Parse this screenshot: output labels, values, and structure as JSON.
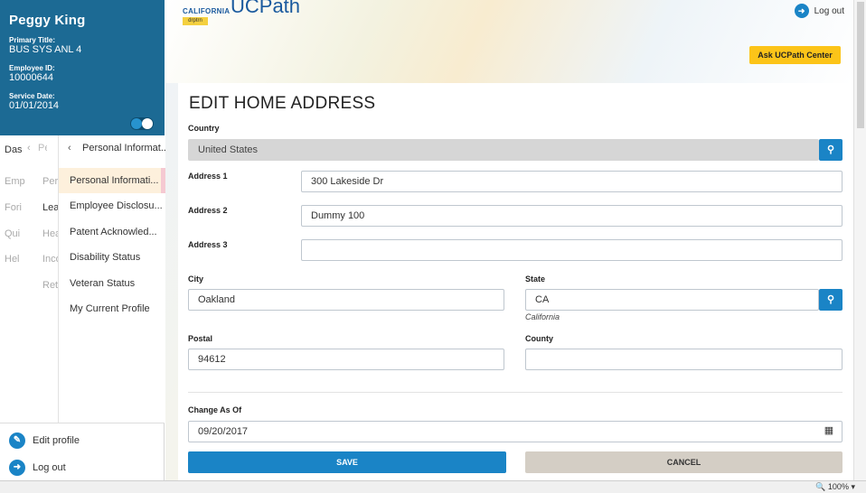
{
  "profile": {
    "name": "Peggy King",
    "primary_title_label": "Primary Title:",
    "primary_title": "BUS SYS ANL 4",
    "employee_id_label": "Employee ID:",
    "employee_id": "10000644",
    "service_date_label": "Service Date:",
    "service_date": "01/01/2014"
  },
  "nav": {
    "level1": [
      "Das",
      "Emp",
      "Fori",
      "Qui",
      "Hel"
    ],
    "level2": [
      "Pers",
      "Lea",
      "Hea",
      "Inco",
      "Reti"
    ],
    "back_short": "Pers",
    "back_label": "Personal Informat...",
    "items": [
      "Personal Informati...",
      "Employee Disclosu...",
      "Patent Acknowled...",
      "Disability Status",
      "Veteran Status",
      "My Current Profile"
    ]
  },
  "sidebar_bottom": {
    "edit_profile": "Edit profile",
    "log_out": "Log out"
  },
  "header": {
    "logo_state": "CALIFORNIA",
    "logo_tag": "drptrn",
    "logo_app": "UCPath",
    "logout": "Log out",
    "ask_center": "Ask UCPath Center"
  },
  "form": {
    "title": "EDIT HOME ADDRESS",
    "country_label": "Country",
    "country_value": "United States",
    "address1_label": "Address 1",
    "address1_value": "300 Lakeside Dr",
    "address2_label": "Address 2",
    "address2_value": "Dummy 100",
    "address3_label": "Address 3",
    "address3_value": "",
    "city_label": "City",
    "city_value": "Oakland",
    "state_label": "State",
    "state_value": "CA",
    "state_desc": "California",
    "postal_label": "Postal",
    "postal_value": "94612",
    "county_label": "County",
    "county_value": "",
    "change_as_of_label": "Change As Of",
    "change_as_of_value": "09/20/2017",
    "save_label": "SAVE",
    "cancel_label": "CANCEL"
  },
  "statusbar": {
    "zoom": "100%"
  },
  "icons": {
    "search": "search-icon",
    "calendar": "calendar-icon",
    "edit": "pencil-icon",
    "logout": "logout-icon"
  },
  "colors": {
    "brand_blue": "#1c6a94",
    "accent_blue": "#1a84c6",
    "ask_yellow": "#fcc419",
    "cancel_gray": "#d4cec5"
  }
}
